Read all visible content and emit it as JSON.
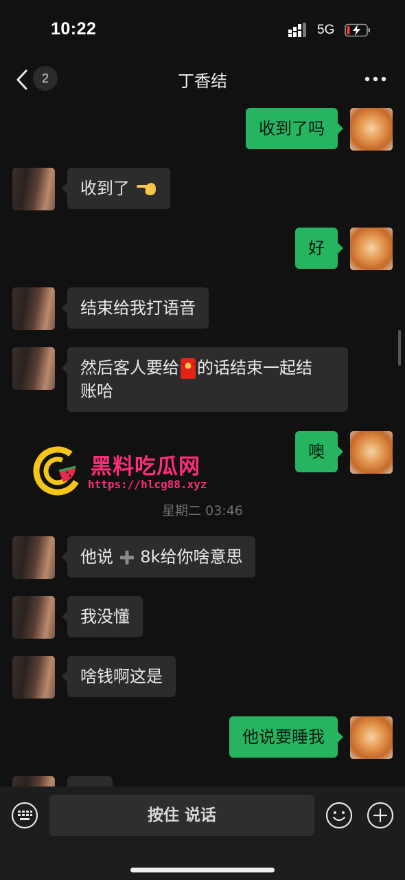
{
  "status": {
    "time": "10:22",
    "network": "5G"
  },
  "nav": {
    "unread": "2",
    "title": "丁香结"
  },
  "messages": {
    "m1": "收到了吗",
    "m2": "收到了",
    "m3": "好",
    "m4": "结束给我打语音",
    "m5a": "然后客人要给",
    "m5b": "的话结束一起结",
    "m5c": "账哈",
    "m6": "噢",
    "timestamp": "星期二 03:46",
    "m7a": "他说",
    "m7b": "8k给你啥意思",
    "m8": "我没懂",
    "m9": "啥钱啊这是",
    "m10": "他说要睡我"
  },
  "watermark": {
    "title": "黑料吃瓜网",
    "url": "https://hlcg88.xyz"
  },
  "input": {
    "hold_label": "按住 说话"
  },
  "colors": {
    "outgoing_bubble": "#26b460",
    "incoming_bubble": "#2c2c2c",
    "watermark": "#ff2d7a"
  }
}
